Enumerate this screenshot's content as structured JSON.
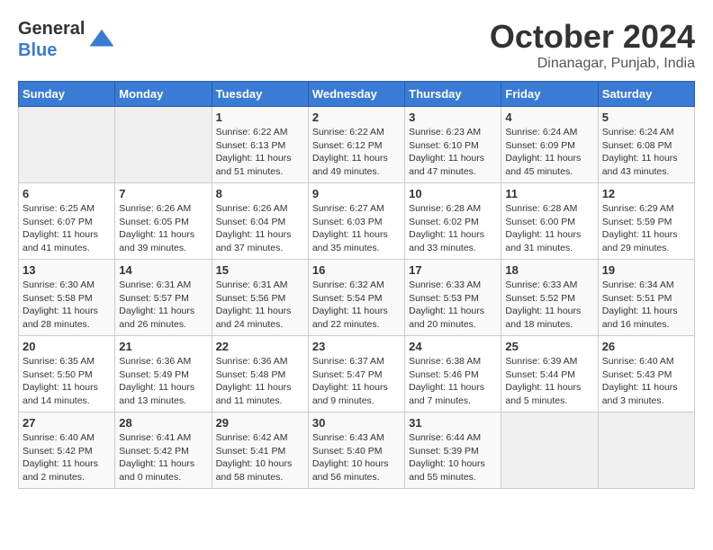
{
  "logo": {
    "text_general": "General",
    "text_blue": "Blue"
  },
  "title": "October 2024",
  "location": "Dinanagar, Punjab, India",
  "headers": [
    "Sunday",
    "Monday",
    "Tuesday",
    "Wednesday",
    "Thursday",
    "Friday",
    "Saturday"
  ],
  "weeks": [
    [
      {
        "day": "",
        "info": ""
      },
      {
        "day": "",
        "info": ""
      },
      {
        "day": "1",
        "info": "Sunrise: 6:22 AM\nSunset: 6:13 PM\nDaylight: 11 hours and 51 minutes."
      },
      {
        "day": "2",
        "info": "Sunrise: 6:22 AM\nSunset: 6:12 PM\nDaylight: 11 hours and 49 minutes."
      },
      {
        "day": "3",
        "info": "Sunrise: 6:23 AM\nSunset: 6:10 PM\nDaylight: 11 hours and 47 minutes."
      },
      {
        "day": "4",
        "info": "Sunrise: 6:24 AM\nSunset: 6:09 PM\nDaylight: 11 hours and 45 minutes."
      },
      {
        "day": "5",
        "info": "Sunrise: 6:24 AM\nSunset: 6:08 PM\nDaylight: 11 hours and 43 minutes."
      }
    ],
    [
      {
        "day": "6",
        "info": "Sunrise: 6:25 AM\nSunset: 6:07 PM\nDaylight: 11 hours and 41 minutes."
      },
      {
        "day": "7",
        "info": "Sunrise: 6:26 AM\nSunset: 6:05 PM\nDaylight: 11 hours and 39 minutes."
      },
      {
        "day": "8",
        "info": "Sunrise: 6:26 AM\nSunset: 6:04 PM\nDaylight: 11 hours and 37 minutes."
      },
      {
        "day": "9",
        "info": "Sunrise: 6:27 AM\nSunset: 6:03 PM\nDaylight: 11 hours and 35 minutes."
      },
      {
        "day": "10",
        "info": "Sunrise: 6:28 AM\nSunset: 6:02 PM\nDaylight: 11 hours and 33 minutes."
      },
      {
        "day": "11",
        "info": "Sunrise: 6:28 AM\nSunset: 6:00 PM\nDaylight: 11 hours and 31 minutes."
      },
      {
        "day": "12",
        "info": "Sunrise: 6:29 AM\nSunset: 5:59 PM\nDaylight: 11 hours and 29 minutes."
      }
    ],
    [
      {
        "day": "13",
        "info": "Sunrise: 6:30 AM\nSunset: 5:58 PM\nDaylight: 11 hours and 28 minutes."
      },
      {
        "day": "14",
        "info": "Sunrise: 6:31 AM\nSunset: 5:57 PM\nDaylight: 11 hours and 26 minutes."
      },
      {
        "day": "15",
        "info": "Sunrise: 6:31 AM\nSunset: 5:56 PM\nDaylight: 11 hours and 24 minutes."
      },
      {
        "day": "16",
        "info": "Sunrise: 6:32 AM\nSunset: 5:54 PM\nDaylight: 11 hours and 22 minutes."
      },
      {
        "day": "17",
        "info": "Sunrise: 6:33 AM\nSunset: 5:53 PM\nDaylight: 11 hours and 20 minutes."
      },
      {
        "day": "18",
        "info": "Sunrise: 6:33 AM\nSunset: 5:52 PM\nDaylight: 11 hours and 18 minutes."
      },
      {
        "day": "19",
        "info": "Sunrise: 6:34 AM\nSunset: 5:51 PM\nDaylight: 11 hours and 16 minutes."
      }
    ],
    [
      {
        "day": "20",
        "info": "Sunrise: 6:35 AM\nSunset: 5:50 PM\nDaylight: 11 hours and 14 minutes."
      },
      {
        "day": "21",
        "info": "Sunrise: 6:36 AM\nSunset: 5:49 PM\nDaylight: 11 hours and 13 minutes."
      },
      {
        "day": "22",
        "info": "Sunrise: 6:36 AM\nSunset: 5:48 PM\nDaylight: 11 hours and 11 minutes."
      },
      {
        "day": "23",
        "info": "Sunrise: 6:37 AM\nSunset: 5:47 PM\nDaylight: 11 hours and 9 minutes."
      },
      {
        "day": "24",
        "info": "Sunrise: 6:38 AM\nSunset: 5:46 PM\nDaylight: 11 hours and 7 minutes."
      },
      {
        "day": "25",
        "info": "Sunrise: 6:39 AM\nSunset: 5:44 PM\nDaylight: 11 hours and 5 minutes."
      },
      {
        "day": "26",
        "info": "Sunrise: 6:40 AM\nSunset: 5:43 PM\nDaylight: 11 hours and 3 minutes."
      }
    ],
    [
      {
        "day": "27",
        "info": "Sunrise: 6:40 AM\nSunset: 5:42 PM\nDaylight: 11 hours and 2 minutes."
      },
      {
        "day": "28",
        "info": "Sunrise: 6:41 AM\nSunset: 5:42 PM\nDaylight: 11 hours and 0 minutes."
      },
      {
        "day": "29",
        "info": "Sunrise: 6:42 AM\nSunset: 5:41 PM\nDaylight: 10 hours and 58 minutes."
      },
      {
        "day": "30",
        "info": "Sunrise: 6:43 AM\nSunset: 5:40 PM\nDaylight: 10 hours and 56 minutes."
      },
      {
        "day": "31",
        "info": "Sunrise: 6:44 AM\nSunset: 5:39 PM\nDaylight: 10 hours and 55 minutes."
      },
      {
        "day": "",
        "info": ""
      },
      {
        "day": "",
        "info": ""
      }
    ]
  ]
}
